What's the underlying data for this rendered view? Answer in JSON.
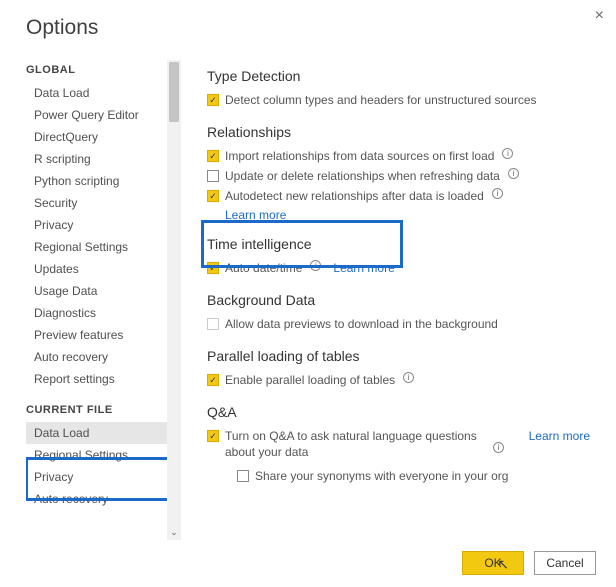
{
  "dialog": {
    "title": "Options",
    "close_icon": "×"
  },
  "sidebar": {
    "groups": [
      {
        "label": "GLOBAL",
        "items": [
          "Data Load",
          "Power Query Editor",
          "DirectQuery",
          "R scripting",
          "Python scripting",
          "Security",
          "Privacy",
          "Regional Settings",
          "Updates",
          "Usage Data",
          "Diagnostics",
          "Preview features",
          "Auto recovery",
          "Report settings"
        ]
      },
      {
        "label": "CURRENT FILE",
        "items": [
          "Data Load",
          "Regional Settings",
          "Privacy",
          "Auto recovery"
        ]
      }
    ],
    "selected": "Data Load"
  },
  "content": {
    "typeDetection": {
      "heading": "Type Detection",
      "opt1": "Detect column types and headers for unstructured sources"
    },
    "relationships": {
      "heading": "Relationships",
      "opt1": "Import relationships from data sources on first load",
      "opt2": "Update or delete relationships when refreshing data",
      "opt3": "Autodetect new relationships after data is loaded",
      "learn": "Learn more"
    },
    "timeIntelligence": {
      "heading": "Time intelligence",
      "opt1": "Auto date/time",
      "learn": "Learn more"
    },
    "backgroundData": {
      "heading": "Background Data",
      "opt1": "Allow data previews to download in the background"
    },
    "parallel": {
      "heading": "Parallel loading of tables",
      "opt1": "Enable parallel loading of tables"
    },
    "qa": {
      "heading": "Q&A",
      "opt1": "Turn on Q&A to ask natural language questions about your data",
      "opt2": "Share your synonyms with everyone in your org",
      "learn": "Learn more"
    }
  },
  "footer": {
    "ok": "OK",
    "cancel": "Cancel"
  },
  "icons": {
    "info": "i",
    "check": "✓",
    "chevron_down": "⌄",
    "cursor": "↖"
  }
}
